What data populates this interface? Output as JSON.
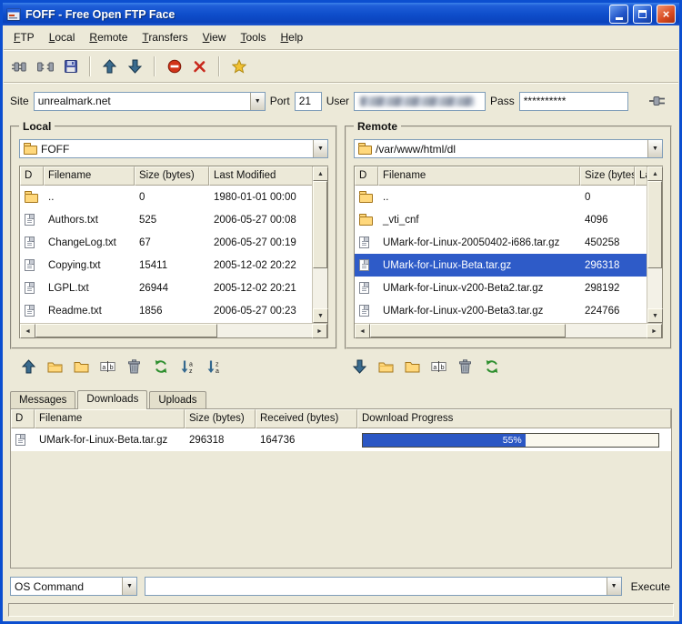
{
  "window": {
    "title": "FOFF - Free Open FTP Face"
  },
  "menu": {
    "items": [
      {
        "label": "FTP"
      },
      {
        "label": "Local"
      },
      {
        "label": "Remote"
      },
      {
        "label": "Transfers"
      },
      {
        "label": "View"
      },
      {
        "label": "Tools"
      },
      {
        "label": "Help"
      }
    ]
  },
  "toolbar": {
    "groups": [
      [
        {
          "name": "connect",
          "icon": "plug-in"
        },
        {
          "name": "disconnect",
          "icon": "plug-out"
        },
        {
          "name": "save",
          "icon": "floppy"
        }
      ],
      [
        {
          "name": "upload",
          "icon": "arrow-up"
        },
        {
          "name": "download",
          "icon": "arrow-down"
        }
      ],
      [
        {
          "name": "stop",
          "icon": "stop"
        },
        {
          "name": "cancel",
          "icon": "cross"
        }
      ],
      [
        {
          "name": "bookmark",
          "icon": "star"
        }
      ]
    ]
  },
  "site_bar": {
    "site_label": "Site",
    "site_value": "unrealmark.net",
    "port_label": "Port",
    "port_value": "21",
    "user_label": "User",
    "user_value": "",
    "pass_label": "Pass",
    "pass_value": "**********"
  },
  "local": {
    "title": "Local",
    "path": "FOFF",
    "columns": [
      "D",
      "Filename",
      "Size (bytes)",
      "Last Modified"
    ],
    "rows": [
      {
        "type": "folder",
        "name": "..",
        "size": "0",
        "modified": "1980-01-01 00:00"
      },
      {
        "type": "file",
        "name": "Authors.txt",
        "size": "525",
        "modified": "2006-05-27 00:08"
      },
      {
        "type": "file",
        "name": "ChangeLog.txt",
        "size": "67",
        "modified": "2006-05-27 00:19"
      },
      {
        "type": "file",
        "name": "Copying.txt",
        "size": "15411",
        "modified": "2005-12-02 20:22"
      },
      {
        "type": "file",
        "name": "LGPL.txt",
        "size": "26944",
        "modified": "2005-12-02 20:21"
      },
      {
        "type": "file",
        "name": "Readme.txt",
        "size": "1856",
        "modified": "2006-05-27 00:23"
      }
    ]
  },
  "remote": {
    "title": "Remote",
    "path": "/var/www/html/dl",
    "columns": [
      "D",
      "Filename",
      "Size (bytes)",
      "Last Modified"
    ],
    "rows": [
      {
        "type": "folder",
        "name": "..",
        "size": "0",
        "modified": "",
        "selected": false
      },
      {
        "type": "folder",
        "name": "_vti_cnf",
        "size": "4096",
        "modified": "",
        "selected": false
      },
      {
        "type": "file",
        "name": "UMark-for-Linux-20050402-i686.tar.gz",
        "size": "450258",
        "modified": "",
        "selected": false
      },
      {
        "type": "file",
        "name": "UMark-for-Linux-Beta.tar.gz",
        "size": "296318",
        "modified": "",
        "selected": true
      },
      {
        "type": "file",
        "name": "UMark-for-Linux-v200-Beta2.tar.gz",
        "size": "298192",
        "modified": "",
        "selected": false
      },
      {
        "type": "file",
        "name": "UMark-for-Linux-v200-Beta3.tar.gz",
        "size": "224766",
        "modified": "",
        "selected": false
      }
    ]
  },
  "local_toolbar": {
    "buttons": [
      {
        "name": "upload",
        "icon": "arrow-up"
      },
      {
        "name": "change-folder",
        "icon": "folder-open"
      },
      {
        "name": "new-folder",
        "icon": "folder"
      },
      {
        "name": "rename",
        "icon": "rename"
      },
      {
        "name": "delete",
        "icon": "trash"
      },
      {
        "name": "refresh",
        "icon": "refresh"
      },
      {
        "name": "sort-asc",
        "icon": "sort-az"
      },
      {
        "name": "sort-desc",
        "icon": "sort-za"
      }
    ]
  },
  "remote_toolbar": {
    "buttons": [
      {
        "name": "download",
        "icon": "arrow-down"
      },
      {
        "name": "change-folder",
        "icon": "folder-open"
      },
      {
        "name": "new-folder",
        "icon": "folder"
      },
      {
        "name": "rename",
        "icon": "rename"
      },
      {
        "name": "delete",
        "icon": "trash"
      },
      {
        "name": "refresh",
        "icon": "refresh"
      }
    ]
  },
  "tabs": [
    {
      "label": "Messages",
      "active": false
    },
    {
      "label": "Downloads",
      "active": true
    },
    {
      "label": "Uploads",
      "active": false
    }
  ],
  "downloads": {
    "columns": [
      "D",
      "Filename",
      "Size (bytes)",
      "Received (bytes)",
      "Download Progress"
    ],
    "rows": [
      {
        "type": "file",
        "name": "UMark-for-Linux-Beta.tar.gz",
        "size": "296318",
        "received": "164736",
        "progress_percent": 55,
        "progress_label": "55%"
      }
    ]
  },
  "command_bar": {
    "selected_command": "OS Command",
    "input_value": "",
    "execute_label": "Execute"
  },
  "icons": {
    "combo_arrow": "▼",
    "scroll_up": "▲",
    "scroll_down": "▼",
    "scroll_left": "◄",
    "scroll_right": "►"
  },
  "colors": {
    "selection": "#2e5bc8",
    "progress_fill": "#2b57c4",
    "titlebar": "#0f4ecb",
    "window_border": "#0c4fd0"
  }
}
